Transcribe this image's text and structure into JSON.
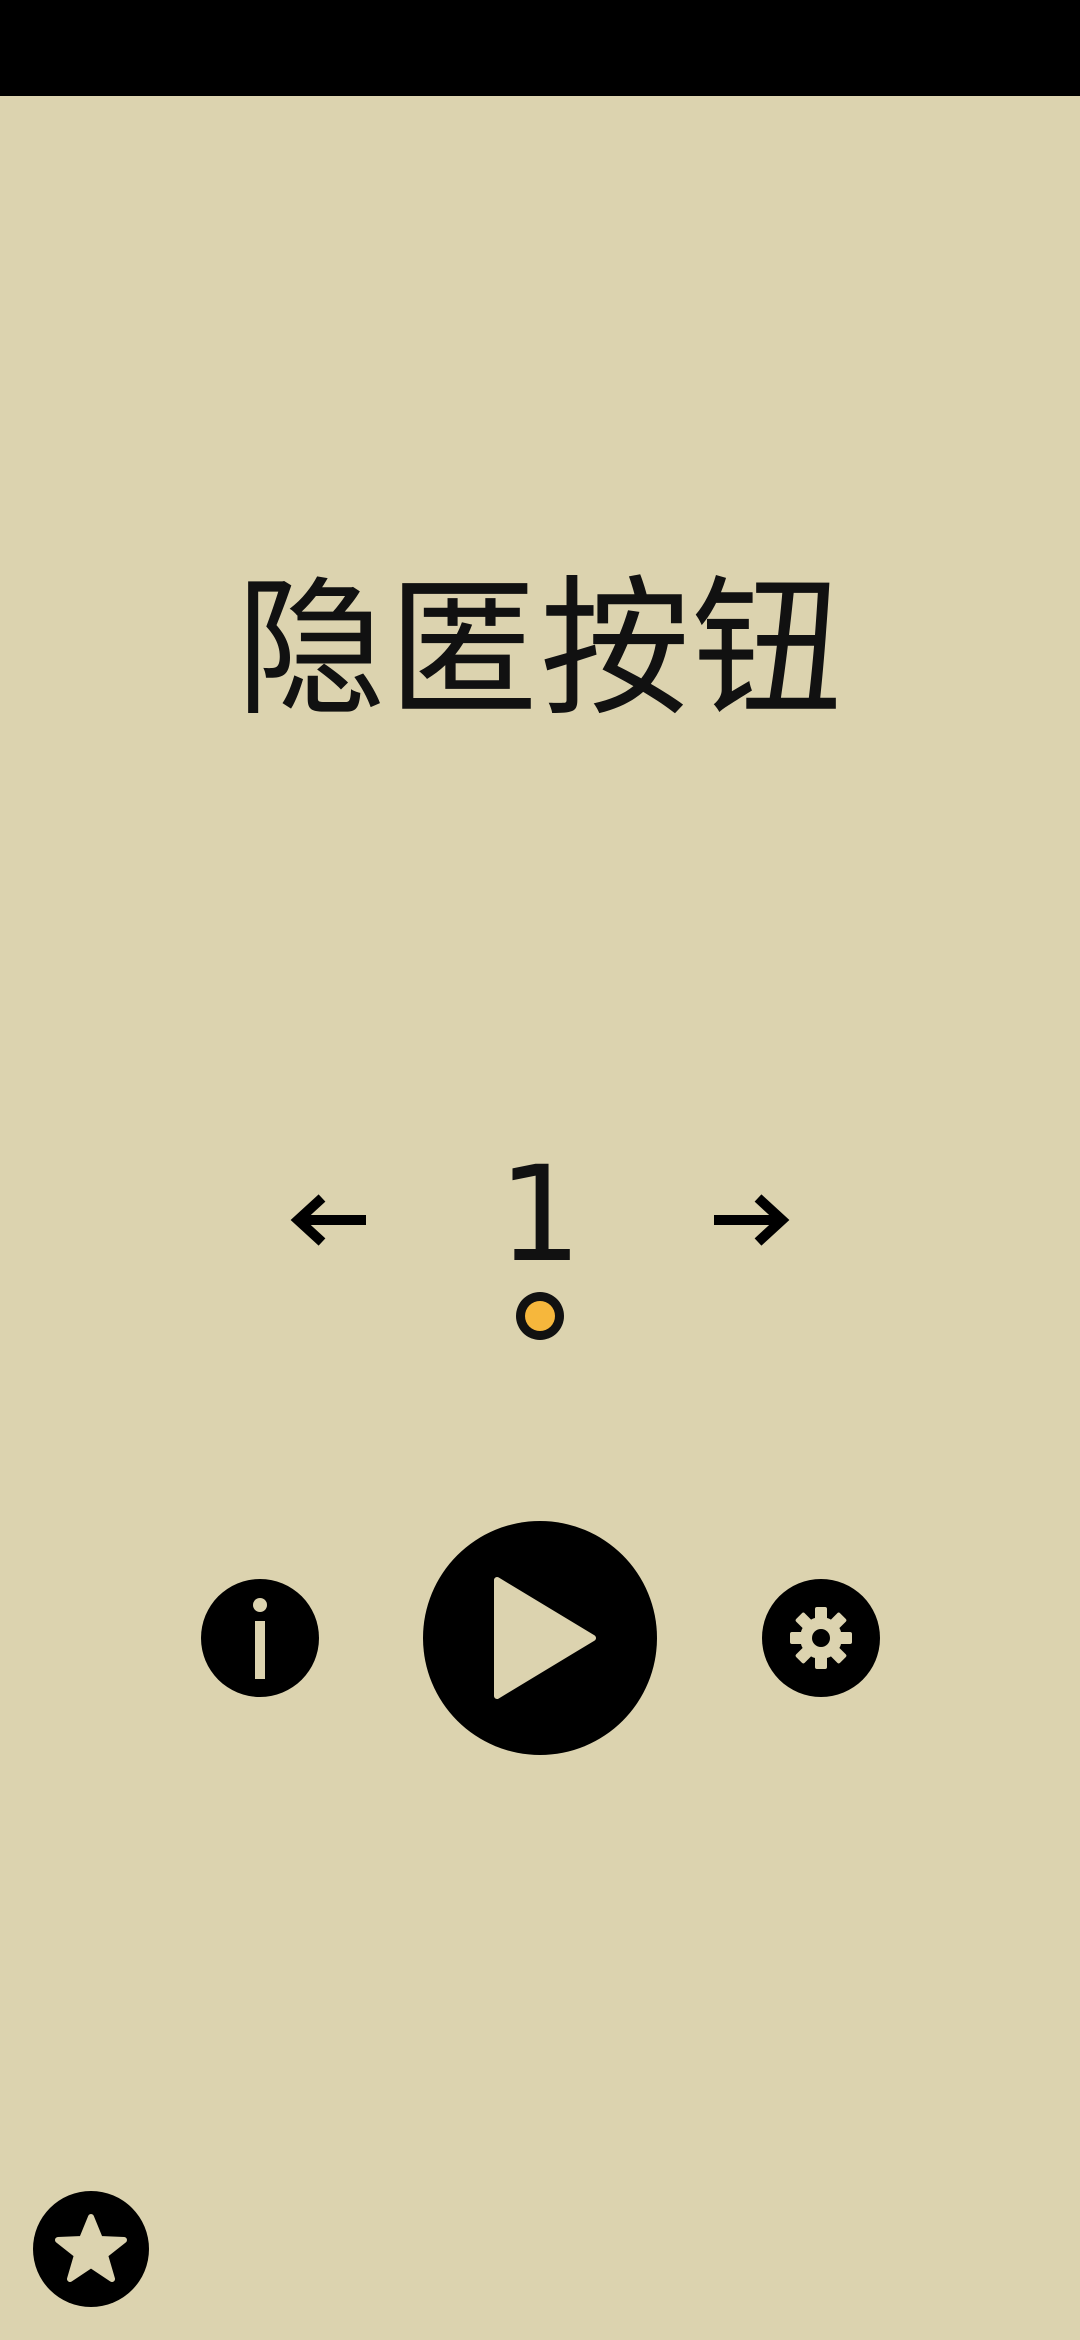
{
  "status_bar": {},
  "title": "隐匿按钮",
  "level_selector": {
    "prev_icon": "arrow-left-icon",
    "current_level": "1",
    "next_icon": "arrow-right-icon",
    "progress_dot_color": "#f6b73c"
  },
  "controls": {
    "info_icon": "info-icon",
    "play_icon": "play-icon",
    "settings_icon": "gear-icon",
    "favorite_icon": "star-icon"
  },
  "colors": {
    "background": "#dcd3af",
    "foreground": "#000000",
    "accent": "#f6b73c"
  }
}
